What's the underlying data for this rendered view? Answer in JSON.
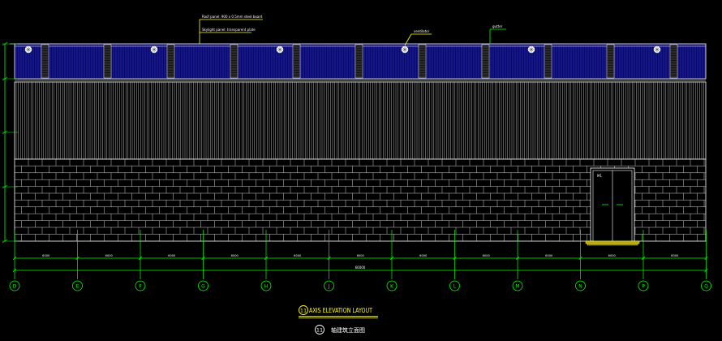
{
  "colors": {
    "background": "#000000",
    "line": "#ffffff",
    "dim": "#00ff00",
    "roof": "#0a0a6e",
    "roof_stripe": "#3030c0",
    "annotation": "#ffff00",
    "title": "#ffff00"
  },
  "annotations": {
    "roof_note_line1": "Roof panel: 900 x 0.5mm steel board",
    "roof_note_line2": "Skylight panel: transparent plate",
    "vent_note": "ventilator",
    "gutter_note": "gutter",
    "door_label": "M1"
  },
  "axes": [
    "D",
    "E",
    "F",
    "G",
    "H",
    "J",
    "K",
    "L",
    "M",
    "N",
    "P",
    "Q"
  ],
  "dimensions": {
    "spans": [
      "6000",
      "6000",
      "6000",
      "6000",
      "6000",
      "6000",
      "6000",
      "6000",
      "6000",
      "6000",
      "6000"
    ],
    "total": "66000"
  },
  "title": {
    "number": "11",
    "en": "AXIS ELEVATION LAYOUT",
    "cn": "轴建筑立面图"
  }
}
